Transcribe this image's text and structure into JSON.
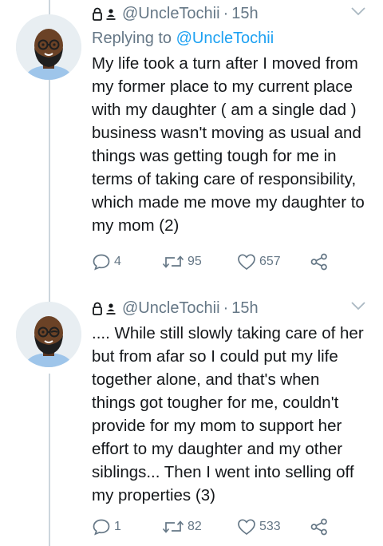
{
  "tweets": [
    {
      "handle": "@UncleTochii",
      "separator": "·",
      "time": "15h",
      "replying_prefix": "Replying to ",
      "replying_handle": "@UncleTochii",
      "text": "My life took a turn after I moved from my former place to my current place with my daughter ( am a single dad ) business wasn't moving as usual and things was getting tough for me in terms of taking care of responsibility, which made me move my daughter to my mom (2)",
      "replies": "4",
      "retweets": "95",
      "likes": "657"
    },
    {
      "handle": "@UncleTochii",
      "separator": "·",
      "time": "15h",
      "text": ".... While still slowly taking care of her but from afar so I could put my life together alone, and that's when things got tougher for me,  couldn't provide for my mom to support her effort to my daughter and my other siblings... Then I went into selling off my properties (3)",
      "replies": "1",
      "retweets": "82",
      "likes": "533"
    }
  ],
  "icons": {
    "lock": "lock-icon",
    "user": "user-icon",
    "chevron": "chevron-down-icon",
    "reply": "reply-icon",
    "retweet": "retweet-icon",
    "like": "heart-icon",
    "share": "share-icon"
  },
  "colors": {
    "text": "#14171a",
    "secondary": "#657786",
    "link": "#1da1f2",
    "thread_line": "#ccd6dd"
  }
}
